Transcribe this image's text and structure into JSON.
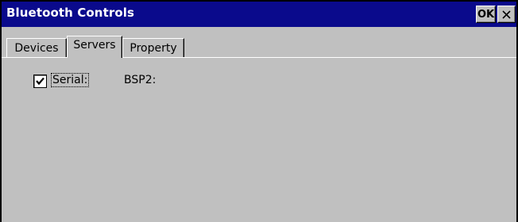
{
  "window": {
    "title": "Bluetooth Controls",
    "ok_label": "OK",
    "close_icon": "close-icon"
  },
  "tabs": [
    {
      "label": "Devices",
      "active": false
    },
    {
      "label": "Servers",
      "active": true
    },
    {
      "label": "Property",
      "active": false
    }
  ],
  "servers": {
    "serial_checkbox": {
      "label": "Serial:",
      "checked": true
    },
    "serial_port": "BSP2:"
  },
  "colors": {
    "titlebar": "#0a0a8c",
    "title_text": "#ffffff",
    "panel": "#c0c0c0"
  }
}
